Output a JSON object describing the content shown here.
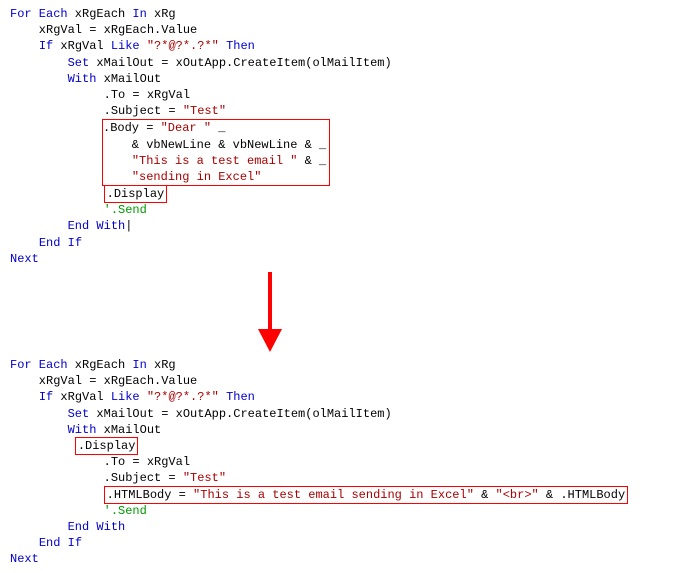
{
  "block1": {
    "l1a": "For Each",
    "l1b": " xRgEach ",
    "l1c": "In",
    "l1d": " xRg",
    "l2": "    xRgVal = xRgEach.Value",
    "l3a": "    ",
    "l3b": "If",
    "l3c": " xRgVal ",
    "l3d": "Like",
    "l3e": " ",
    "l3f": "\"?*@?*.?*\"",
    "l3g": " ",
    "l3h": "Then",
    "l4a": "        ",
    "l4b": "Set",
    "l4c": " xMailOut = xOutApp.CreateItem(olMailItem)",
    "l5a": "        ",
    "l5b": "With",
    "l5c": " xMailOut",
    "l6": "             .To = xRgVal",
    "l7a": "             .Subject = ",
    "l7b": "\"Test\"",
    "box": {
      "bl1a": ".Body = ",
      "bl1b": "\"Dear \"",
      "bl1c": " _",
      "bl2a": "    & vbNewLine & vbNewLine & _",
      "bl3a": "    ",
      "bl3b": "\"This is a test email \"",
      "bl3c": " & _",
      "bl4a": "    ",
      "bl4b": "\"sending in Excel\""
    },
    "disp": ".Display",
    "l9a": "             ",
    "l9b": "'.Send",
    "l10a": "        ",
    "l10b": "End With",
    "l10c": "|",
    "l11a": "    ",
    "l11b": "End If",
    "l12": "Next"
  },
  "block2": {
    "l1a": "For Each",
    "l1b": " xRgEach ",
    "l1c": "In",
    "l1d": " xRg",
    "l2": "    xRgVal = xRgEach.Value",
    "l3a": "    ",
    "l3b": "If",
    "l3c": " xRgVal ",
    "l3d": "Like",
    "l3e": " ",
    "l3f": "\"?*@?*.?*\"",
    "l3g": " ",
    "l3h": "Then",
    "l4a": "        ",
    "l4b": "Set",
    "l4c": " xMailOut = xOutApp.CreateItem(olMailItem)",
    "l5a": "        ",
    "l5b": "With",
    "l5c": " xMailOut",
    "disp": ".Display",
    "l6": "             .To = xRgVal",
    "l7a": "             .Subject = ",
    "l7b": "\"Test\"",
    "hl_a": ".HTMLBody = ",
    "hl_b": "\"This is a test email sending in Excel\"",
    "hl_c": " & ",
    "hl_d": "\"<br>\"",
    "hl_e": " & .HTMLBody",
    "l9a": "             ",
    "l9b": "'.Send",
    "l10a": "        ",
    "l10b": "End With",
    "l11a": "    ",
    "l11b": "End If",
    "l12": "Next"
  }
}
